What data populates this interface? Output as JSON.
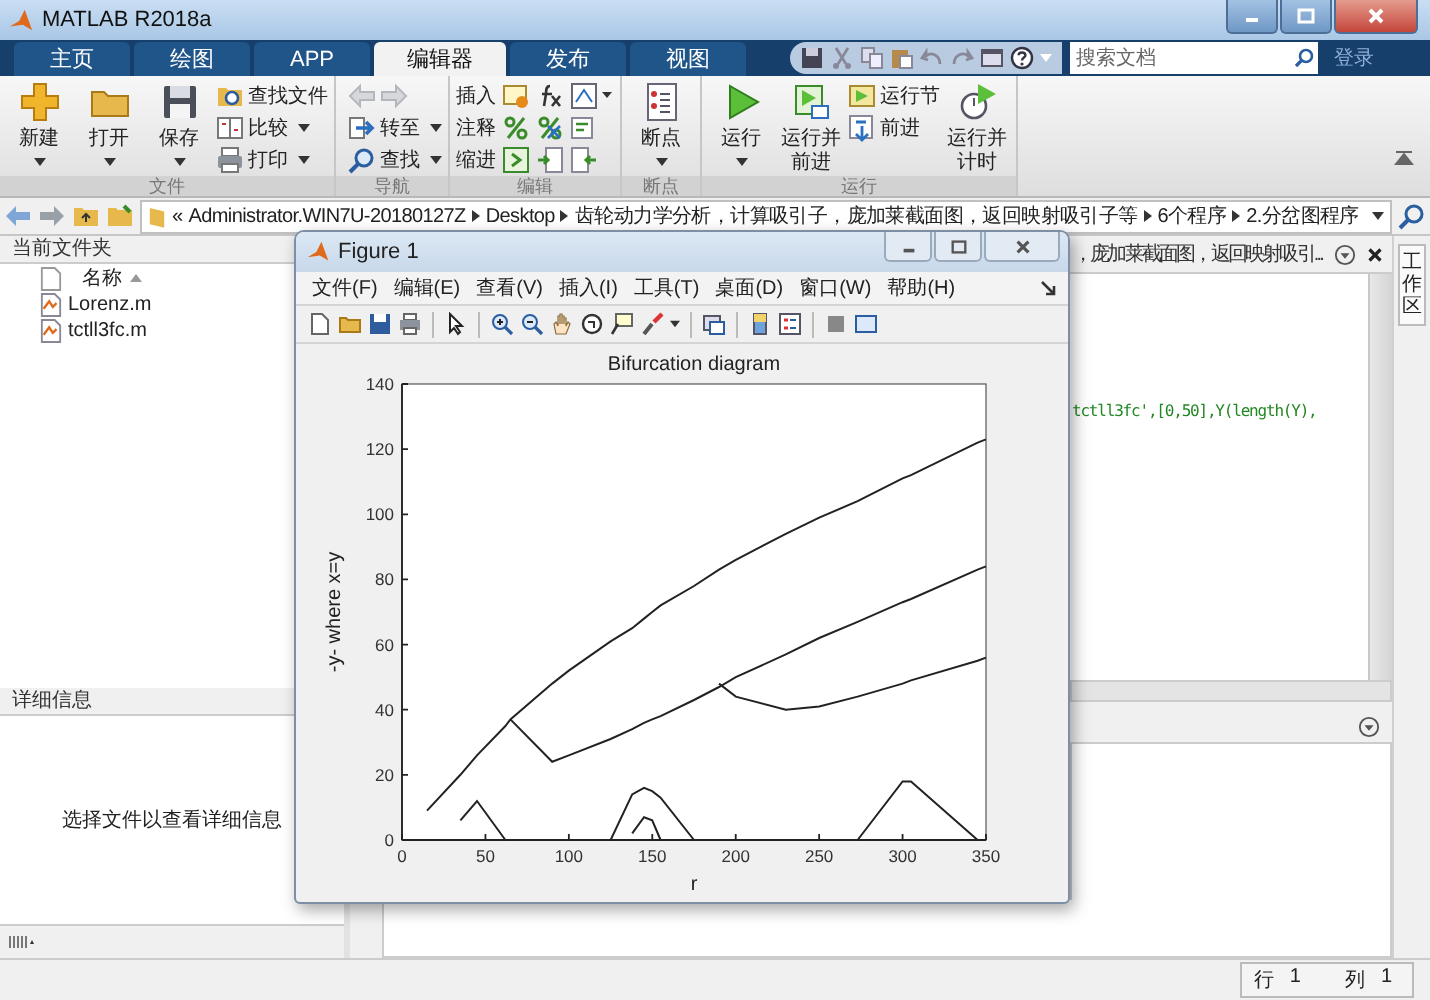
{
  "window": {
    "title": "MATLAB R2018a"
  },
  "tabs": [
    {
      "label": "主页",
      "selected": false
    },
    {
      "label": "绘图",
      "selected": false
    },
    {
      "label": "APP",
      "selected": false
    },
    {
      "label": "编辑器",
      "selected": true
    },
    {
      "label": "发布",
      "selected": false
    },
    {
      "label": "视图",
      "selected": false
    }
  ],
  "search": {
    "placeholder": "搜索文档"
  },
  "sign_in": "登录",
  "ribbon": {
    "file": {
      "label": "文件",
      "new": "新建",
      "open": "打开",
      "save": "保存",
      "find_files": "查找文件",
      "compare": "比较",
      "print": "打印"
    },
    "navigate": {
      "label": "导航",
      "go_to": "转至",
      "find": "查找"
    },
    "edit": {
      "label": "编辑",
      "insert": "插入",
      "comment": "注释",
      "indent": "缩进"
    },
    "breakpoints": {
      "label": "断点",
      "breakpoints": "断点"
    },
    "run": {
      "label": "运行",
      "run": "运行",
      "run_and_advance": "运行并前进",
      "run_section": "运行节",
      "advance": "前进",
      "run_and_time": "运行并计时"
    }
  },
  "address": {
    "more": "«",
    "segments": [
      "Administrator.WIN7U-20180127Z",
      "Desktop",
      "齿轮动力学分析，计算吸引子，庞加莱截面图，返回映射吸引子等",
      "6个程序",
      "2.分岔图程序"
    ]
  },
  "current_folder": {
    "title": "当前文件夹",
    "column": "名称",
    "files": [
      "Lorenz.m",
      "tctll3fc.m"
    ]
  },
  "details": {
    "title": "详细信息",
    "message": "选择文件以查看详细信息"
  },
  "editor": {
    "tab_title": "，庞加莱截面图，返回映射吸引...",
    "code": "tctll3fc',[0,50],Y(length(Y),"
  },
  "workspace_tab": "工作区",
  "status": {
    "row_label": "行",
    "row": "1",
    "col_label": "列",
    "col": "1"
  },
  "figure": {
    "title": "Figure 1",
    "menus": [
      "文件(F)",
      "编辑(E)",
      "查看(V)",
      "插入(I)",
      "工具(T)",
      "桌面(D)",
      "窗口(W)",
      "帮助(H)"
    ],
    "chart_data": {
      "type": "line",
      "title": "Bifurcation diagram",
      "xlabel": "r",
      "ylabel": "-y- where x=y",
      "x": [
        15,
        35,
        45,
        62,
        65,
        90,
        100,
        125,
        138,
        145,
        150,
        155,
        175,
        190,
        200,
        230,
        250,
        273,
        300,
        305,
        345,
        350
      ],
      "series": [
        {
          "values": [
            9,
            20,
            26,
            35,
            37,
            48,
            52,
            61,
            65,
            68,
            70,
            72,
            78,
            83,
            86,
            94,
            99,
            104,
            111,
            112,
            122,
            123
          ]
        },
        {
          "values": [
            null,
            null,
            null,
            null,
            37,
            24,
            26,
            31,
            34,
            36,
            37,
            38,
            43,
            47,
            50,
            57,
            62,
            67,
            73,
            74,
            83,
            84
          ]
        },
        {
          "values": [
            null,
            null,
            null,
            null,
            null,
            null,
            null,
            null,
            null,
            null,
            null,
            null,
            null,
            48,
            44,
            40,
            41,
            44,
            48,
            49,
            55,
            56
          ]
        },
        {
          "values": [
            null,
            6,
            12,
            0,
            null,
            null,
            null,
            null,
            null,
            null,
            null,
            null,
            null,
            null,
            null,
            null,
            null,
            null,
            null,
            null,
            null,
            null
          ]
        },
        {
          "values": [
            null,
            null,
            null,
            null,
            null,
            null,
            null,
            0,
            14,
            16,
            15,
            13,
            0,
            null,
            null,
            null,
            null,
            null,
            null,
            null,
            null,
            null
          ]
        },
        {
          "values": [
            null,
            null,
            null,
            null,
            null,
            null,
            null,
            null,
            2,
            7,
            6,
            0,
            null,
            null,
            null,
            null,
            null,
            null,
            null,
            null,
            null,
            null
          ]
        },
        {
          "values": [
            null,
            null,
            null,
            null,
            null,
            null,
            null,
            null,
            null,
            null,
            null,
            null,
            null,
            null,
            null,
            null,
            null,
            0,
            18,
            18,
            0,
            null
          ]
        }
      ],
      "xlim": [
        0,
        350
      ],
      "ylim": [
        0,
        140
      ],
      "xticks": [
        0,
        50,
        100,
        150,
        200,
        250,
        300,
        350
      ],
      "yticks": [
        0,
        20,
        40,
        60,
        80,
        100,
        120,
        140
      ]
    }
  }
}
